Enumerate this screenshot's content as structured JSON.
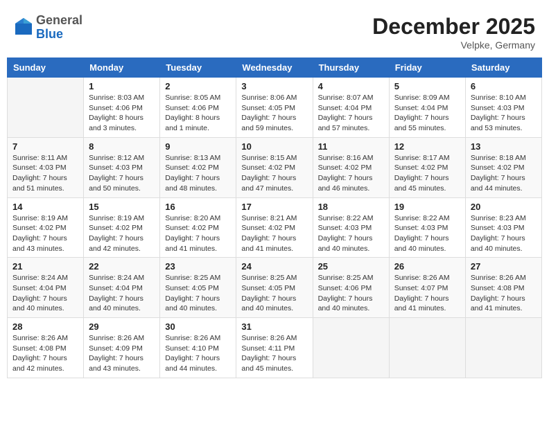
{
  "header": {
    "logo": {
      "general": "General",
      "blue": "Blue"
    },
    "title": "December 2025",
    "subtitle": "Velpke, Germany"
  },
  "weekdays": [
    "Sunday",
    "Monday",
    "Tuesday",
    "Wednesday",
    "Thursday",
    "Friday",
    "Saturday"
  ],
  "weeks": [
    [
      {
        "day": "",
        "sunrise": "",
        "sunset": "",
        "daylight": ""
      },
      {
        "day": "1",
        "sunrise": "Sunrise: 8:03 AM",
        "sunset": "Sunset: 4:06 PM",
        "daylight": "Daylight: 8 hours and 3 minutes."
      },
      {
        "day": "2",
        "sunrise": "Sunrise: 8:05 AM",
        "sunset": "Sunset: 4:06 PM",
        "daylight": "Daylight: 8 hours and 1 minute."
      },
      {
        "day": "3",
        "sunrise": "Sunrise: 8:06 AM",
        "sunset": "Sunset: 4:05 PM",
        "daylight": "Daylight: 7 hours and 59 minutes."
      },
      {
        "day": "4",
        "sunrise": "Sunrise: 8:07 AM",
        "sunset": "Sunset: 4:04 PM",
        "daylight": "Daylight: 7 hours and 57 minutes."
      },
      {
        "day": "5",
        "sunrise": "Sunrise: 8:09 AM",
        "sunset": "Sunset: 4:04 PM",
        "daylight": "Daylight: 7 hours and 55 minutes."
      },
      {
        "day": "6",
        "sunrise": "Sunrise: 8:10 AM",
        "sunset": "Sunset: 4:03 PM",
        "daylight": "Daylight: 7 hours and 53 minutes."
      }
    ],
    [
      {
        "day": "7",
        "sunrise": "Sunrise: 8:11 AM",
        "sunset": "Sunset: 4:03 PM",
        "daylight": "Daylight: 7 hours and 51 minutes."
      },
      {
        "day": "8",
        "sunrise": "Sunrise: 8:12 AM",
        "sunset": "Sunset: 4:03 PM",
        "daylight": "Daylight: 7 hours and 50 minutes."
      },
      {
        "day": "9",
        "sunrise": "Sunrise: 8:13 AM",
        "sunset": "Sunset: 4:02 PM",
        "daylight": "Daylight: 7 hours and 48 minutes."
      },
      {
        "day": "10",
        "sunrise": "Sunrise: 8:15 AM",
        "sunset": "Sunset: 4:02 PM",
        "daylight": "Daylight: 7 hours and 47 minutes."
      },
      {
        "day": "11",
        "sunrise": "Sunrise: 8:16 AM",
        "sunset": "Sunset: 4:02 PM",
        "daylight": "Daylight: 7 hours and 46 minutes."
      },
      {
        "day": "12",
        "sunrise": "Sunrise: 8:17 AM",
        "sunset": "Sunset: 4:02 PM",
        "daylight": "Daylight: 7 hours and 45 minutes."
      },
      {
        "day": "13",
        "sunrise": "Sunrise: 8:18 AM",
        "sunset": "Sunset: 4:02 PM",
        "daylight": "Daylight: 7 hours and 44 minutes."
      }
    ],
    [
      {
        "day": "14",
        "sunrise": "Sunrise: 8:19 AM",
        "sunset": "Sunset: 4:02 PM",
        "daylight": "Daylight: 7 hours and 43 minutes."
      },
      {
        "day": "15",
        "sunrise": "Sunrise: 8:19 AM",
        "sunset": "Sunset: 4:02 PM",
        "daylight": "Daylight: 7 hours and 42 minutes."
      },
      {
        "day": "16",
        "sunrise": "Sunrise: 8:20 AM",
        "sunset": "Sunset: 4:02 PM",
        "daylight": "Daylight: 7 hours and 41 minutes."
      },
      {
        "day": "17",
        "sunrise": "Sunrise: 8:21 AM",
        "sunset": "Sunset: 4:02 PM",
        "daylight": "Daylight: 7 hours and 41 minutes."
      },
      {
        "day": "18",
        "sunrise": "Sunrise: 8:22 AM",
        "sunset": "Sunset: 4:03 PM",
        "daylight": "Daylight: 7 hours and 40 minutes."
      },
      {
        "day": "19",
        "sunrise": "Sunrise: 8:22 AM",
        "sunset": "Sunset: 4:03 PM",
        "daylight": "Daylight: 7 hours and 40 minutes."
      },
      {
        "day": "20",
        "sunrise": "Sunrise: 8:23 AM",
        "sunset": "Sunset: 4:03 PM",
        "daylight": "Daylight: 7 hours and 40 minutes."
      }
    ],
    [
      {
        "day": "21",
        "sunrise": "Sunrise: 8:24 AM",
        "sunset": "Sunset: 4:04 PM",
        "daylight": "Daylight: 7 hours and 40 minutes."
      },
      {
        "day": "22",
        "sunrise": "Sunrise: 8:24 AM",
        "sunset": "Sunset: 4:04 PM",
        "daylight": "Daylight: 7 hours and 40 minutes."
      },
      {
        "day": "23",
        "sunrise": "Sunrise: 8:25 AM",
        "sunset": "Sunset: 4:05 PM",
        "daylight": "Daylight: 7 hours and 40 minutes."
      },
      {
        "day": "24",
        "sunrise": "Sunrise: 8:25 AM",
        "sunset": "Sunset: 4:05 PM",
        "daylight": "Daylight: 7 hours and 40 minutes."
      },
      {
        "day": "25",
        "sunrise": "Sunrise: 8:25 AM",
        "sunset": "Sunset: 4:06 PM",
        "daylight": "Daylight: 7 hours and 40 minutes."
      },
      {
        "day": "26",
        "sunrise": "Sunrise: 8:26 AM",
        "sunset": "Sunset: 4:07 PM",
        "daylight": "Daylight: 7 hours and 41 minutes."
      },
      {
        "day": "27",
        "sunrise": "Sunrise: 8:26 AM",
        "sunset": "Sunset: 4:08 PM",
        "daylight": "Daylight: 7 hours and 41 minutes."
      }
    ],
    [
      {
        "day": "28",
        "sunrise": "Sunrise: 8:26 AM",
        "sunset": "Sunset: 4:08 PM",
        "daylight": "Daylight: 7 hours and 42 minutes."
      },
      {
        "day": "29",
        "sunrise": "Sunrise: 8:26 AM",
        "sunset": "Sunset: 4:09 PM",
        "daylight": "Daylight: 7 hours and 43 minutes."
      },
      {
        "day": "30",
        "sunrise": "Sunrise: 8:26 AM",
        "sunset": "Sunset: 4:10 PM",
        "daylight": "Daylight: 7 hours and 44 minutes."
      },
      {
        "day": "31",
        "sunrise": "Sunrise: 8:26 AM",
        "sunset": "Sunset: 4:11 PM",
        "daylight": "Daylight: 7 hours and 45 minutes."
      },
      {
        "day": "",
        "sunrise": "",
        "sunset": "",
        "daylight": ""
      },
      {
        "day": "",
        "sunrise": "",
        "sunset": "",
        "daylight": ""
      },
      {
        "day": "",
        "sunrise": "",
        "sunset": "",
        "daylight": ""
      }
    ]
  ]
}
